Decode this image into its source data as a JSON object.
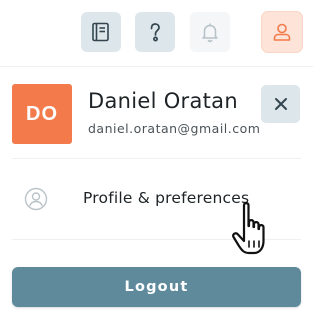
{
  "topbar": {
    "icons": [
      "book-icon",
      "help-icon",
      "bell-icon",
      "user-icon"
    ]
  },
  "profile": {
    "initials": "DO",
    "name": "Daniel Oratan",
    "email": "daniel.oratan@gmail.com",
    "avatar_color": "#f37a4b"
  },
  "menu": {
    "items": [
      {
        "label": "Profile & preferences",
        "icon": "user-circle-icon"
      }
    ]
  },
  "actions": {
    "logout_label": "Logout"
  },
  "colors": {
    "accent": "#5f8a9c",
    "icon_bg": "#dde6ea",
    "active_bg": "#fde3d8",
    "active_icon": "#f37a4b"
  }
}
